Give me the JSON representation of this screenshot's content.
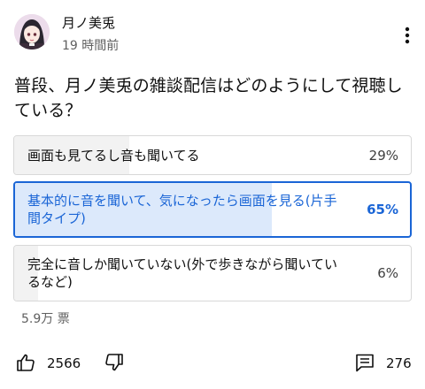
{
  "post": {
    "author": "月ノ美兎",
    "time": "19 時間前",
    "question": "普段、月ノ美兎の雑談配信はどのようにして視聴している？"
  },
  "poll": {
    "options": [
      {
        "label": "画面も見てるし音も聞いてる",
        "percent": "29%",
        "fraction": 0.29,
        "selected": false
      },
      {
        "label": "基本的に音を聞いて、気になったら画面を見る(片手間タイプ)",
        "percent": "65%",
        "fraction": 0.65,
        "selected": true
      },
      {
        "label": "完全に音しか聞いていない(外で歩きながら聞いているなど)",
        "percent": "6%",
        "fraction": 0.06,
        "selected": false
      }
    ],
    "votes": "5.9万 票"
  },
  "actions": {
    "like_count": "2566",
    "comment_count": "276"
  },
  "icons": {
    "more": "more-vert-icon",
    "like": "thumb-up-icon",
    "dislike": "thumb-down-icon",
    "comment": "comment-icon"
  },
  "colors": {
    "accent": "#1a65d6",
    "selected_fill": "#dce9fb",
    "fill": "#f2f2f2",
    "border": "#d8d8d8"
  }
}
